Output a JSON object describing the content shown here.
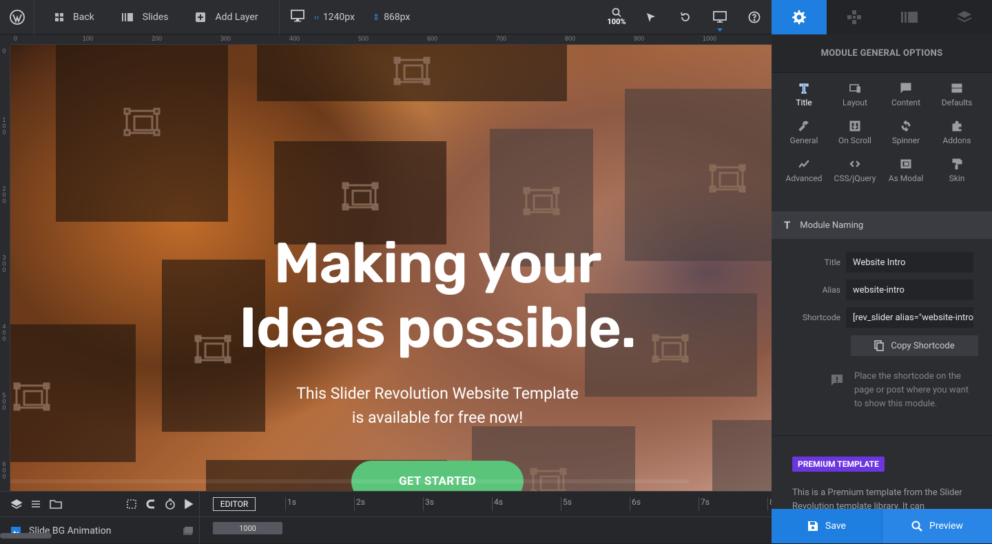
{
  "toolbar": {
    "back_label": "Back",
    "slides_label": "Slides",
    "add_layer_label": "Add Layer",
    "width_value": "1240px",
    "height_value": "868px",
    "zoom_label": "100%"
  },
  "ruler": {
    "horizontal": [
      "0",
      "100",
      "200",
      "300",
      "400",
      "500",
      "600",
      "700",
      "800",
      "900",
      "1000"
    ],
    "vertical": [
      "0",
      "100",
      "200",
      "300",
      "400",
      "500",
      "600"
    ]
  },
  "slide": {
    "headline_line1": "Making your",
    "headline_line2": "Ideas possible.",
    "sub_line1": "This Slider Revolution Website Template",
    "sub_line2": "is available for free now!",
    "cta_label": "GET STARTED"
  },
  "timeline": {
    "editor_label": "EDITOR",
    "ticks": [
      "1s",
      "2s",
      "3s",
      "4s",
      "5s",
      "6s",
      "7s",
      "8"
    ],
    "bg_animation_label": "Slide BG Animation",
    "bar_value": "1000"
  },
  "panel": {
    "title": "MODULE GENERAL OPTIONS",
    "options": [
      {
        "label": "Title",
        "icon": "title-icon"
      },
      {
        "label": "Layout",
        "icon": "layout-icon"
      },
      {
        "label": "Content",
        "icon": "content-icon"
      },
      {
        "label": "Defaults",
        "icon": "defaults-icon"
      },
      {
        "label": "General",
        "icon": "wrench-icon"
      },
      {
        "label": "On Scroll",
        "icon": "on-scroll-icon"
      },
      {
        "label": "Spinner",
        "icon": "spinner-icon"
      },
      {
        "label": "Addons",
        "icon": "puzzle-icon"
      },
      {
        "label": "Advanced",
        "icon": "trend-icon"
      },
      {
        "label": "CSS/jQuery",
        "icon": "code-icon"
      },
      {
        "label": "As Modal",
        "icon": "modal-icon"
      },
      {
        "label": "Skin",
        "icon": "paint-roller-icon"
      }
    ],
    "section_label": "Module Naming",
    "fields": {
      "title_label": "Title",
      "title_value": "Website Intro",
      "alias_label": "Alias",
      "alias_value": "website-intro",
      "shortcode_label": "Shortcode",
      "shortcode_value": "[rev_slider alias=\"website-intro\"]"
    },
    "copy_label": "Copy Shortcode",
    "info_text": "Place the shortcode on the page or post where you want to show this module.",
    "premium_badge": "PREMIUM TEMPLATE",
    "premium_text": "This is a Premium template from the Slider Revolution template library. It can",
    "save_label": "Save",
    "preview_label": "Preview"
  },
  "colors": {
    "accent": "#1e7fe0",
    "cta": "#5ac57a",
    "premium": "#6b36e0"
  }
}
